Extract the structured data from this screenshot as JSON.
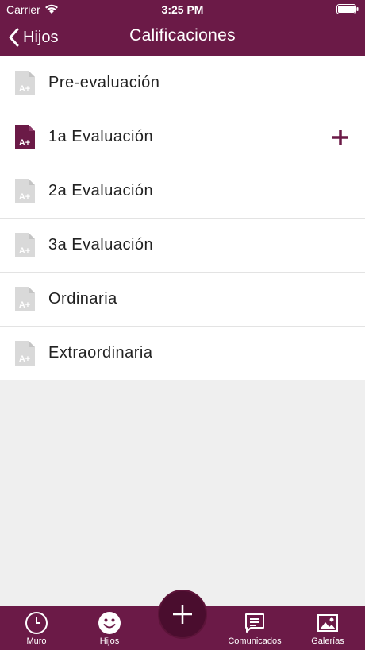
{
  "status_bar": {
    "carrier": "Carrier",
    "time": "3:25 PM"
  },
  "nav": {
    "back_label": "Hijos",
    "title": "Calificaciones"
  },
  "items": [
    {
      "label": "Pre-evaluación",
      "active": false
    },
    {
      "label": "1a Evaluación",
      "active": true
    },
    {
      "label": "2a Evaluación",
      "active": false
    },
    {
      "label": "3a Evaluación",
      "active": false
    },
    {
      "label": "Ordinaria",
      "active": false
    },
    {
      "label": "Extraordinaria",
      "active": false
    }
  ],
  "tabs": [
    {
      "label": "Muro",
      "icon": "clock-icon"
    },
    {
      "label": "Hijos",
      "icon": "smiley-icon"
    },
    {
      "label": "Comunicados",
      "icon": "message-icon"
    },
    {
      "label": "Galerías",
      "icon": "image-icon"
    }
  ],
  "colors": {
    "primary": "#6b1a47",
    "fab": "#4a0d2e",
    "inactive_icon": "#d9d9d9",
    "background": "#efefef"
  }
}
